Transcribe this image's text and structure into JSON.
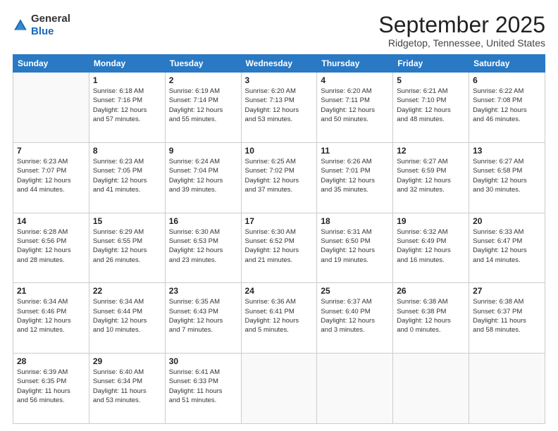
{
  "logo": {
    "general": "General",
    "blue": "Blue"
  },
  "title": "September 2025",
  "subtitle": "Ridgetop, Tennessee, United States",
  "header_days": [
    "Sunday",
    "Monday",
    "Tuesday",
    "Wednesday",
    "Thursday",
    "Friday",
    "Saturday"
  ],
  "weeks": [
    [
      {
        "day": "",
        "info": ""
      },
      {
        "day": "1",
        "info": "Sunrise: 6:18 AM\nSunset: 7:16 PM\nDaylight: 12 hours\nand 57 minutes."
      },
      {
        "day": "2",
        "info": "Sunrise: 6:19 AM\nSunset: 7:14 PM\nDaylight: 12 hours\nand 55 minutes."
      },
      {
        "day": "3",
        "info": "Sunrise: 6:20 AM\nSunset: 7:13 PM\nDaylight: 12 hours\nand 53 minutes."
      },
      {
        "day": "4",
        "info": "Sunrise: 6:20 AM\nSunset: 7:11 PM\nDaylight: 12 hours\nand 50 minutes."
      },
      {
        "day": "5",
        "info": "Sunrise: 6:21 AM\nSunset: 7:10 PM\nDaylight: 12 hours\nand 48 minutes."
      },
      {
        "day": "6",
        "info": "Sunrise: 6:22 AM\nSunset: 7:08 PM\nDaylight: 12 hours\nand 46 minutes."
      }
    ],
    [
      {
        "day": "7",
        "info": "Sunrise: 6:23 AM\nSunset: 7:07 PM\nDaylight: 12 hours\nand 44 minutes."
      },
      {
        "day": "8",
        "info": "Sunrise: 6:23 AM\nSunset: 7:05 PM\nDaylight: 12 hours\nand 41 minutes."
      },
      {
        "day": "9",
        "info": "Sunrise: 6:24 AM\nSunset: 7:04 PM\nDaylight: 12 hours\nand 39 minutes."
      },
      {
        "day": "10",
        "info": "Sunrise: 6:25 AM\nSunset: 7:02 PM\nDaylight: 12 hours\nand 37 minutes."
      },
      {
        "day": "11",
        "info": "Sunrise: 6:26 AM\nSunset: 7:01 PM\nDaylight: 12 hours\nand 35 minutes."
      },
      {
        "day": "12",
        "info": "Sunrise: 6:27 AM\nSunset: 6:59 PM\nDaylight: 12 hours\nand 32 minutes."
      },
      {
        "day": "13",
        "info": "Sunrise: 6:27 AM\nSunset: 6:58 PM\nDaylight: 12 hours\nand 30 minutes."
      }
    ],
    [
      {
        "day": "14",
        "info": "Sunrise: 6:28 AM\nSunset: 6:56 PM\nDaylight: 12 hours\nand 28 minutes."
      },
      {
        "day": "15",
        "info": "Sunrise: 6:29 AM\nSunset: 6:55 PM\nDaylight: 12 hours\nand 26 minutes."
      },
      {
        "day": "16",
        "info": "Sunrise: 6:30 AM\nSunset: 6:53 PM\nDaylight: 12 hours\nand 23 minutes."
      },
      {
        "day": "17",
        "info": "Sunrise: 6:30 AM\nSunset: 6:52 PM\nDaylight: 12 hours\nand 21 minutes."
      },
      {
        "day": "18",
        "info": "Sunrise: 6:31 AM\nSunset: 6:50 PM\nDaylight: 12 hours\nand 19 minutes."
      },
      {
        "day": "19",
        "info": "Sunrise: 6:32 AM\nSunset: 6:49 PM\nDaylight: 12 hours\nand 16 minutes."
      },
      {
        "day": "20",
        "info": "Sunrise: 6:33 AM\nSunset: 6:47 PM\nDaylight: 12 hours\nand 14 minutes."
      }
    ],
    [
      {
        "day": "21",
        "info": "Sunrise: 6:34 AM\nSunset: 6:46 PM\nDaylight: 12 hours\nand 12 minutes."
      },
      {
        "day": "22",
        "info": "Sunrise: 6:34 AM\nSunset: 6:44 PM\nDaylight: 12 hours\nand 10 minutes."
      },
      {
        "day": "23",
        "info": "Sunrise: 6:35 AM\nSunset: 6:43 PM\nDaylight: 12 hours\nand 7 minutes."
      },
      {
        "day": "24",
        "info": "Sunrise: 6:36 AM\nSunset: 6:41 PM\nDaylight: 12 hours\nand 5 minutes."
      },
      {
        "day": "25",
        "info": "Sunrise: 6:37 AM\nSunset: 6:40 PM\nDaylight: 12 hours\nand 3 minutes."
      },
      {
        "day": "26",
        "info": "Sunrise: 6:38 AM\nSunset: 6:38 PM\nDaylight: 12 hours\nand 0 minutes."
      },
      {
        "day": "27",
        "info": "Sunrise: 6:38 AM\nSunset: 6:37 PM\nDaylight: 11 hours\nand 58 minutes."
      }
    ],
    [
      {
        "day": "28",
        "info": "Sunrise: 6:39 AM\nSunset: 6:35 PM\nDaylight: 11 hours\nand 56 minutes."
      },
      {
        "day": "29",
        "info": "Sunrise: 6:40 AM\nSunset: 6:34 PM\nDaylight: 11 hours\nand 53 minutes."
      },
      {
        "day": "30",
        "info": "Sunrise: 6:41 AM\nSunset: 6:33 PM\nDaylight: 11 hours\nand 51 minutes."
      },
      {
        "day": "",
        "info": ""
      },
      {
        "day": "",
        "info": ""
      },
      {
        "day": "",
        "info": ""
      },
      {
        "day": "",
        "info": ""
      }
    ]
  ]
}
